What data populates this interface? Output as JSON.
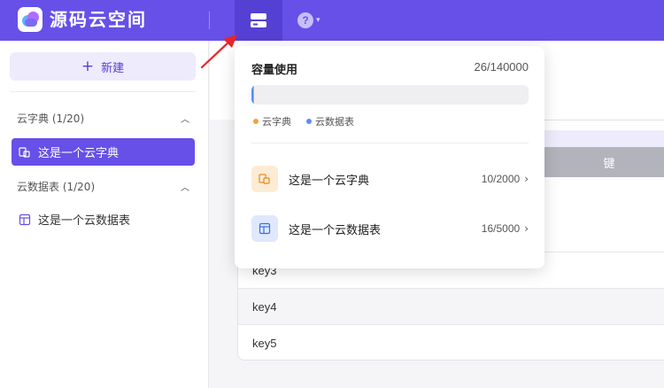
{
  "app": {
    "brand": "源码云空间"
  },
  "topbar": {
    "help_label": "?"
  },
  "sidebar": {
    "new_button": "新建",
    "groups": [
      {
        "label": "云字典 (1/20)",
        "items": [
          {
            "label": "这是一个云字典",
            "active": true
          }
        ]
      },
      {
        "label": "云数据表 (1/20)",
        "items": [
          {
            "label": "这是一个云数据表",
            "active": false
          }
        ]
      }
    ]
  },
  "table": {
    "column_header": "键",
    "rows": [
      "key3",
      "key4",
      "key5"
    ]
  },
  "capacity_popover": {
    "title": "容量使用",
    "count": "26/140000",
    "usage_fraction": 0.000186,
    "legend": [
      {
        "label": "云字典",
        "color": "#f2a23b"
      },
      {
        "label": "云数据表",
        "color": "#5b8cf0"
      }
    ],
    "items": [
      {
        "name": "这是一个云字典",
        "usage": "10/2000",
        "icon": "dictionary-icon"
      },
      {
        "name": "这是一个云数据表",
        "usage": "16/5000",
        "icon": "datatable-icon"
      }
    ]
  },
  "colors": {
    "accent": "#6650e8",
    "annotation_arrow": "#e8242b"
  }
}
